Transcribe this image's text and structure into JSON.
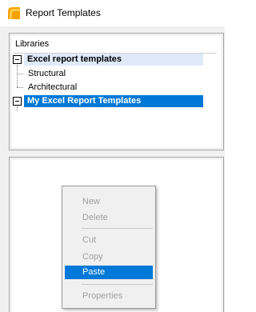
{
  "window": {
    "title": "Report Templates"
  },
  "tree": {
    "header": "Libraries",
    "libraries": [
      {
        "label": "Excel report templates",
        "children": [
          "Structural",
          "Architectural"
        ]
      },
      {
        "label": "My Excel Report Templates",
        "children": []
      }
    ]
  },
  "context_menu": {
    "items": [
      {
        "label": "New",
        "enabled": false
      },
      {
        "label": "Delete",
        "enabled": false
      },
      {
        "label": "Cut",
        "enabled": false
      },
      {
        "label": "Copy",
        "enabled": false
      },
      {
        "label": "Paste",
        "enabled": true,
        "highlighted": true
      },
      {
        "label": "Properties",
        "enabled": false
      }
    ]
  },
  "colors": {
    "selection": "#0078d7",
    "hover_row": "#dfe9f8",
    "menu_bg": "#f0f0f0"
  }
}
